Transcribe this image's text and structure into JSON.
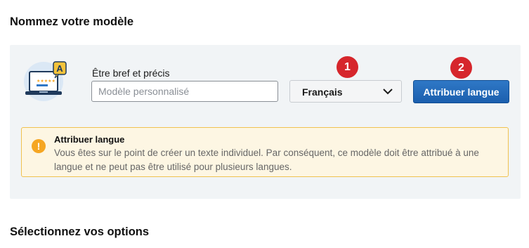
{
  "section_titles": {
    "name_model": "Nommez votre modèle",
    "select_options": "Sélectionnez vos options"
  },
  "name_field": {
    "label": "Être bref et précis",
    "placeholder": "Modèle personnalisé",
    "value": ""
  },
  "language_select": {
    "selected": "Français"
  },
  "assign_button": {
    "label": "Attribuer langue"
  },
  "step_badges": [
    "1",
    "2"
  ],
  "alert": {
    "icon": "exclamation-icon",
    "icon_glyph": "!",
    "title": "Attribuer langue",
    "message": "Vous êtes sur le point de créer un texte individuel. Par conséquent, ce modèle doit être attribué à une langue et ne peut pas être utilisé pour plusieurs langues."
  },
  "illustration": {
    "badge_letter": "A"
  },
  "colors": {
    "panel_bg": "#f1f4f6",
    "button_blue": "#1b5fae",
    "badge_red": "#d6262c",
    "alert_bg": "#fdf6e3",
    "alert_border": "#f0c24f",
    "alert_icon": "#f5a623"
  }
}
